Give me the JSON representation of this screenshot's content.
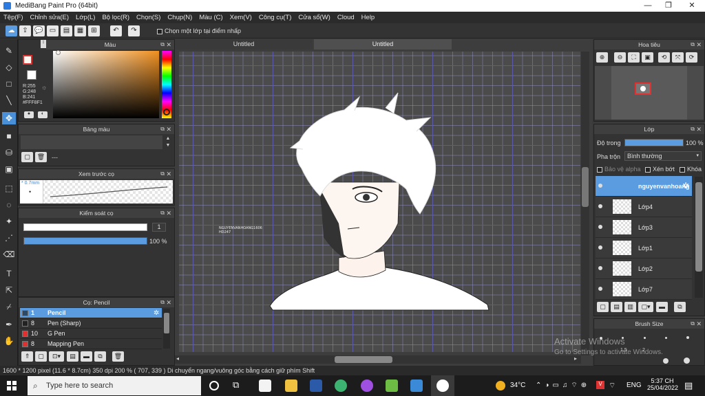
{
  "window": {
    "title": "MediBang Paint Pro (64bit)",
    "minimize": "—",
    "maximize": "❐",
    "close": "✕"
  },
  "menu": [
    "Tệp(F)",
    "Chỉnh sửa(E)",
    "Lớp(L)",
    "Bộ lọc(R)",
    "Chọn(S)",
    "Chụp(N)",
    "Màu (C)",
    "Xem(V)",
    "Công cụ(T)",
    "Cửa sổ(W)",
    "Cloud",
    "Help"
  ],
  "toolbar": {
    "checkbox_label": "Chọn một lớp tại điểm nhấp"
  },
  "color_panel": {
    "title": "Màu",
    "rgb_r": "R:255",
    "rgb_g": "G:248",
    "rgb_b": "B:241",
    "hex": "#FFF8F1",
    "primary_color": "#fff8f1",
    "secondary_color": "#ffffff"
  },
  "palette_panel": {
    "title": "Bảng màu",
    "field": "---"
  },
  "brush_preview_panel": {
    "title": "Xem trước cọ",
    "size": "* 0.7mm",
    "dot": "•"
  },
  "brush_control_panel": {
    "title": "Kiểm soát cọ",
    "size_value": "1",
    "opacity_value": "100 %",
    "opacity": 1.0
  },
  "brush_list_panel": {
    "title": "Cọ: Pencil",
    "items": [
      {
        "num": "1",
        "name": "Pencil",
        "color": "#2b4a6a"
      },
      {
        "num": "8",
        "name": "Pen (Sharp)",
        "color": "#222222"
      },
      {
        "num": "10",
        "name": "G Pen",
        "color": "#e03030"
      },
      {
        "num": "8",
        "name": "Mapping Pen",
        "color": "#e03030"
      }
    ]
  },
  "canvas": {
    "tabs": [
      "Untitled",
      "Untitled"
    ],
    "watermark_line1": "NGUYENVANHOANG1606",
    "watermark_line2": "HD247"
  },
  "navigator_panel": {
    "title": "Hoa tiêu"
  },
  "layer_panel": {
    "title": "Lớp",
    "opacity_label": "Độ trong",
    "opacity_value": "100 %",
    "opacity": 1.0,
    "blend_label": "Pha trộn",
    "blend_value": "Bình thường",
    "protect_alpha": "Bảo vệ alpha",
    "clip": "Xén bớt",
    "lock": "Khóa",
    "layers": [
      "nguyenvanhoang",
      "Lớp4",
      "Lớp3",
      "Lớp1",
      "Lớp2",
      "Lớp7"
    ]
  },
  "brush_size_panel": {
    "title": "Brush Size",
    "label_a": "1.5",
    "label_b": "2"
  },
  "activation": {
    "line1": "Activate Windows",
    "line2": "Go to Settings to activate Windows."
  },
  "statusbar": {
    "info": "1600 * 1200 pixel   (11.6 * 8.7cm)   350 dpi   200 %   ( 707, 339 )   Di chuyển ngang/vuông góc bằng cách giữ phím Shift"
  },
  "taskbar": {
    "search_placeholder": "Type here to search",
    "temperature": "34°C",
    "language": "ENG",
    "time": "5:37 CH",
    "date": "25/04/2022"
  }
}
